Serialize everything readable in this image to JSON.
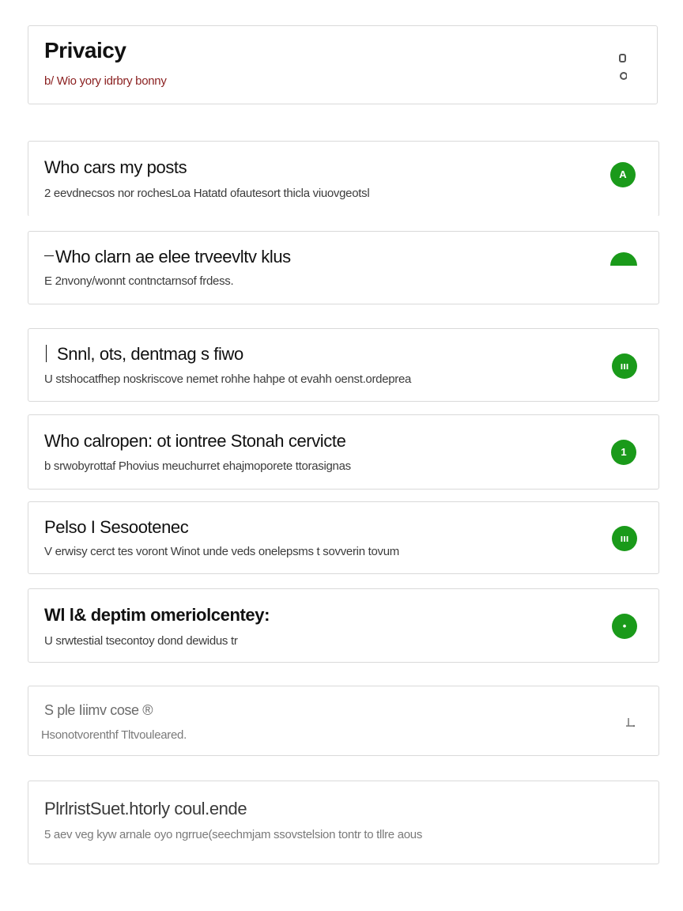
{
  "header": {
    "title": "Privaicy",
    "subtitle": "b/ Wio yory idrbry bonny"
  },
  "settings": [
    {
      "title": "Who cars my posts",
      "description": "2 eevdnecsos nor rochesLoa Hatatd ofautesort thicla viuovgeotsl",
      "toggle_label": "A"
    },
    {
      "title": "Who clarn ae elee trveevltv klus",
      "description": "E 2nvony/wonnt contnctarnsof frdess.",
      "toggle_label": ""
    },
    {
      "title": "Snnl, ots, dentmag s fiwo",
      "description": "U stshocatfhep noskriscove nemet rohhe hahpe ot evahh oenst.ordeprea",
      "toggle_label": "ııı"
    },
    {
      "title": "Who calropen: ot iontree Stonah cervicte",
      "description": "b srwobyrottaf Phovius meuchurret ehajmoporete ttorasignas",
      "toggle_label": "1"
    },
    {
      "title": "Pelso I Sesootenec",
      "description": "V erwisy cerct tes voront Winot unde veds onelepsms t sovverin tovum",
      "toggle_label": "ııı"
    },
    {
      "title": "Wl l& deptim omeriolcentey:",
      "description": "U srwtestial tsecontoy dond dewidus tr",
      "toggle_label": "•"
    },
    {
      "title": "S ple Iiimv cose ®",
      "description": "Hsonotvorenthf Tltvouleared.",
      "toggle_label": ""
    },
    {
      "title": "PlrlristSuet.htorly coul.ende",
      "description": "5 aev veg kyw arnale oyo ngrrue(seechmjam ssovstelsion tontr to tllre aous",
      "toggle_label": ""
    }
  ],
  "colors": {
    "toggle_on": "#1a9a1a",
    "header_subtitle": "#8a1f1f",
    "card_border": "#d9d9d9"
  }
}
